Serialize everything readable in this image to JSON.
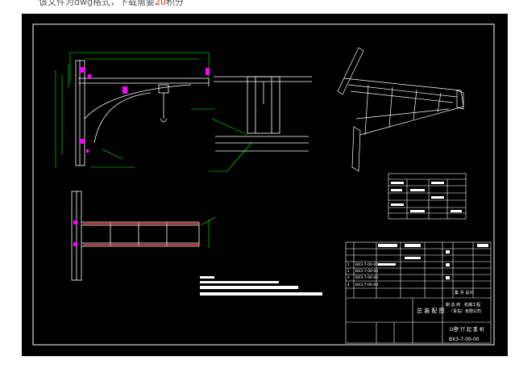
{
  "caption": {
    "prefix": "该文件为dwg格式，下载需要",
    "cost": "20",
    "suffix": "积分"
  },
  "drawing": {
    "colors": {
      "background": "#000000",
      "line": "#ffffff",
      "dimension": "#00ff00",
      "highlight": "#ff00ff",
      "member": "#ff4040"
    },
    "title_block": {
      "parts": [
        {
          "no": "1",
          "code": "BX3-7-00-00"
        },
        {
          "no": "2",
          "code": "BX3-7-00-00"
        },
        {
          "no": "3",
          "code": "BX3-7-00-00"
        },
        {
          "no": "4",
          "code": "BX3-7-00-00"
        }
      ],
      "designer_label": "集 共 设计",
      "company": "制 造 商 · 机械工程",
      "company_sub": "（青岛）有限公司",
      "drawing_title": "总 装 配 图",
      "product_name": "1t壁 行 起 重 机",
      "drawing_no": "BX3-7-00-00"
    }
  }
}
